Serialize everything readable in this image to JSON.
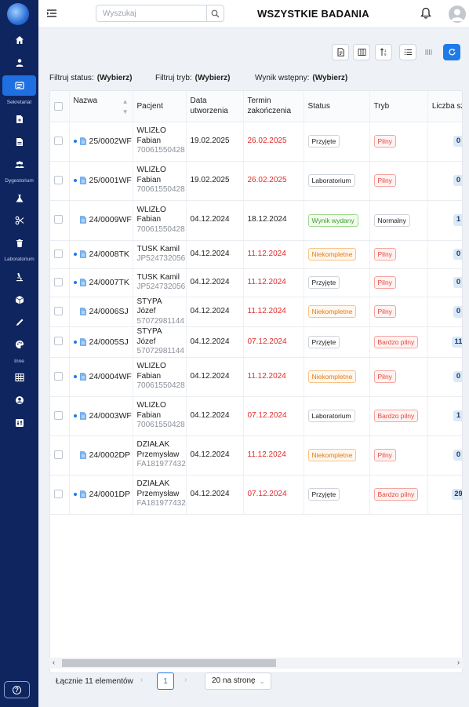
{
  "header": {
    "title": "WSZYSTKIE BADANIA",
    "search_placeholder": "Wyszukaj"
  },
  "sidebar": {
    "sections": [
      "Sekretariat",
      "Dygestorium",
      "Laboratorium",
      "Inne"
    ],
    "icons": [
      "home-icon",
      "user-icon",
      "list-icon",
      "add-document-icon",
      "document-icon",
      "users-icon",
      "flask-icon",
      "scissors-icon",
      "trash-icon",
      "microscope-icon",
      "box-icon",
      "pen-icon",
      "palette-icon",
      "table-icon",
      "account-icon",
      "sliders-icon"
    ],
    "help_icon": "question-icon"
  },
  "filters": {
    "status_label": "Filtruj status:",
    "status_value": "(Wybierz)",
    "mode_label": "Filtruj tryb:",
    "mode_value": "(Wybierz)",
    "result_label": "Wynik wstępny:",
    "result_value": "(Wybierz)"
  },
  "table": {
    "columns": [
      "Nazwa",
      "Pacjent",
      "Data utworzenia",
      "Termin zakończenia",
      "Status",
      "Tryb",
      "Liczba szkiełek"
    ],
    "rows": [
      {
        "dot": true,
        "name": "25/0002WF",
        "patient": "WLIZŁO Fabian",
        "pid": "70061550428",
        "created": "19.02.2025",
        "deadline": "26.02.2025",
        "deadline_red": true,
        "status": "Przyjęte",
        "status_style": "default",
        "mode": "Pilny",
        "mode_style": "red",
        "slides": "0"
      },
      {
        "dot": true,
        "name": "25/0001WF",
        "patient": "WLIZŁO Fabian",
        "pid": "70061550428",
        "created": "19.02.2025",
        "deadline": "26.02.2025",
        "deadline_red": true,
        "status": "Laboratorium",
        "status_style": "default",
        "mode": "Pilny",
        "mode_style": "red",
        "slides": "0"
      },
      {
        "dot": false,
        "name": "24/0009WF",
        "patient": "WLIZŁO Fabian",
        "pid": "70061550428",
        "created": "04.12.2024",
        "deadline": "18.12.2024",
        "deadline_red": false,
        "status": "Wynik wydany",
        "status_style": "green",
        "mode": "Normalny",
        "mode_style": "default",
        "slides": "1"
      },
      {
        "dot": true,
        "name": "24/0008TK",
        "patient": "TUSK Kamil",
        "pid": "JP524732056",
        "created": "04.12.2024",
        "deadline": "11.12.2024",
        "deadline_red": true,
        "status": "Niekompletne",
        "status_style": "orange",
        "mode": "Pilny",
        "mode_style": "red",
        "slides": "0"
      },
      {
        "dot": true,
        "name": "24/0007TK",
        "patient": "TUSK Kamil",
        "pid": "JP524732056",
        "created": "04.12.2024",
        "deadline": "11.12.2024",
        "deadline_red": true,
        "status": "Przyjęte",
        "status_style": "default",
        "mode": "Pilny",
        "mode_style": "red",
        "slides": "0"
      },
      {
        "dot": false,
        "name": "24/0006SJ",
        "patient": "STYPA Józef",
        "pid": "57072981144",
        "created": "04.12.2024",
        "deadline": "11.12.2024",
        "deadline_red": true,
        "status": "Niekompletne",
        "status_style": "orange",
        "mode": "Pilny",
        "mode_style": "red",
        "slides": "0"
      },
      {
        "dot": true,
        "name": "24/0005SJ",
        "patient": "STYPA Józef",
        "pid": "57072981144",
        "created": "04.12.2024",
        "deadline": "07.12.2024",
        "deadline_red": true,
        "status": "Przyjęte",
        "status_style": "default",
        "mode": "Bardzo pilny",
        "mode_style": "red",
        "slides": "11"
      },
      {
        "dot": true,
        "name": "24/0004WF",
        "patient": "WLIZŁO Fabian",
        "pid": "70061550428",
        "created": "04.12.2024",
        "deadline": "11.12.2024",
        "deadline_red": true,
        "status": "Niekompletne",
        "status_style": "orange",
        "mode": "Pilny",
        "mode_style": "red",
        "slides": "0"
      },
      {
        "dot": true,
        "name": "24/0003WF",
        "patient": "WLIZŁO Fabian",
        "pid": "70061550428",
        "created": "04.12.2024",
        "deadline": "07.12.2024",
        "deadline_red": true,
        "status": "Laboratorium",
        "status_style": "default",
        "mode": "Bardzo pilny",
        "mode_style": "red",
        "slides": "1"
      },
      {
        "dot": false,
        "name": "24/0002DP",
        "patient": "DZIAŁAK Przemysław",
        "pid": "FA181977432",
        "created": "04.12.2024",
        "deadline": "11.12.2024",
        "deadline_red": true,
        "status": "Niekompletne",
        "status_style": "orange",
        "mode": "Pilny",
        "mode_style": "red",
        "slides": "0"
      },
      {
        "dot": true,
        "name": "24/0001DP",
        "patient": "DZIAŁAK Przemysław",
        "pid": "FA181977432",
        "created": "04.12.2024",
        "deadline": "07.12.2024",
        "deadline_red": true,
        "status": "Przyjęte",
        "status_style": "default",
        "mode": "Bardzo pilny",
        "mode_style": "red",
        "slides": "29"
      }
    ]
  },
  "pagination": {
    "total": "Łącznie 11 elementów",
    "current_page": "1",
    "per_page": "20 na stronę"
  },
  "colors": {
    "sidebar": "#0f2560",
    "accent": "#1f7be8",
    "deadline_red": "#e02b2b"
  }
}
